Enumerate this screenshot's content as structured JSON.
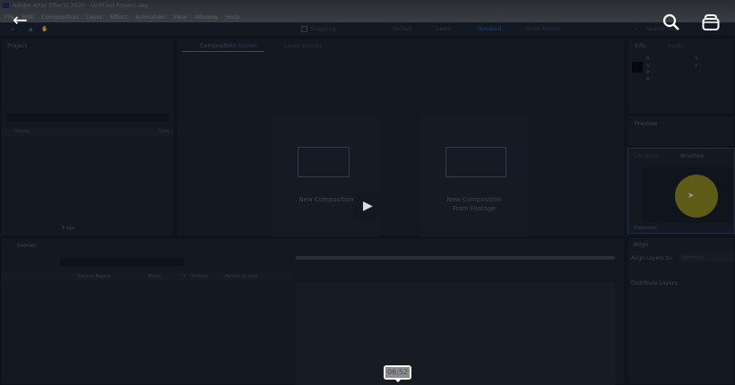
{
  "window": {
    "title": "Adobe After Effects 2020 - Untitled Project.aep"
  },
  "menu": [
    "File",
    "Edit",
    "Composition",
    "Layer",
    "Effect",
    "Animation",
    "View",
    "Window",
    "Help"
  ],
  "toolbar": {
    "snapping": "Snapping",
    "workspaces": [
      "Default",
      "Learn",
      "Standard",
      "Small Screen"
    ],
    "search_placeholder": "Search Help"
  },
  "project": {
    "title": "Project",
    "columns": {
      "name": "Name",
      "type": "Type"
    },
    "bpc": "8 bpc"
  },
  "composition": {
    "tab": "Composition",
    "tab_suffix": "(none)",
    "layer_tab": "Layer (none)",
    "new_comp": "New Composition",
    "new_from_footage_1": "New Composition",
    "new_from_footage_2": "From Footage"
  },
  "info": {
    "tab": "Info",
    "audio": "Audio",
    "rgba": [
      "R :",
      "G :",
      "B :",
      "A :"
    ],
    "xy": [
      "X :",
      "Y :"
    ]
  },
  "preview": {
    "title": "Preview"
  },
  "brushes": {
    "libraries": "Libraries",
    "brushes": "Brushes",
    "diameter": "Diameter:"
  },
  "align": {
    "title": "Align",
    "align_to": "Align Layers to:",
    "selection": "Selection",
    "distribute": "Distribute Layers:"
  },
  "timeline": {
    "tab": "(none)",
    "columns": [
      "Source Name",
      "Mode",
      "T",
      "TrkMat",
      "Parent & Link"
    ]
  },
  "player": {
    "timestamp": "06:52"
  }
}
